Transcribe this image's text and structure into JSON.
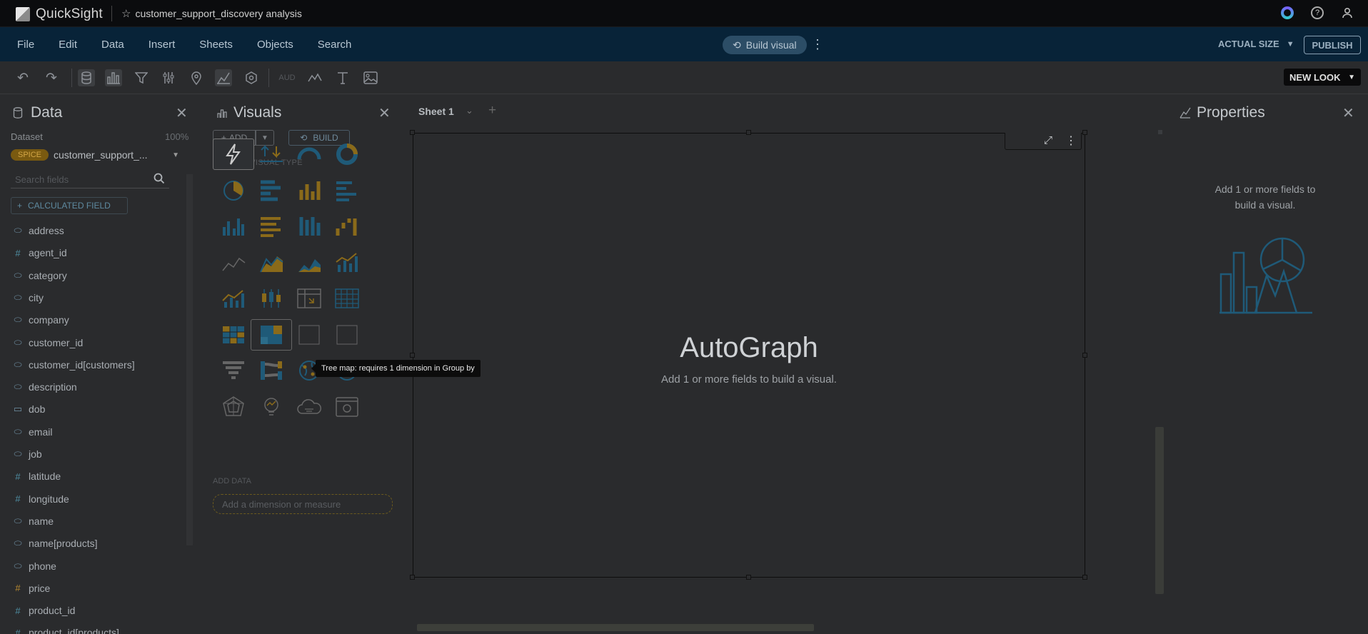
{
  "topbar": {
    "app_name": "QuickSight",
    "analysis_name": "customer_support_discovery analysis"
  },
  "menubar": {
    "menus": [
      "File",
      "Edit",
      "Data",
      "Insert",
      "Sheets",
      "Objects",
      "Search"
    ],
    "build_visual": "Build visual",
    "size_label": "ACTUAL SIZE",
    "publish": "PUBLISH"
  },
  "toolbar": {
    "new_look": "NEW LOOK",
    "aud_label": "AUD"
  },
  "data_panel": {
    "title": "Data",
    "dataset_label": "Dataset",
    "dataset_percent": "100%",
    "spice_badge": "SPICE",
    "dataset_name": "customer_support_...",
    "search_placeholder": "Search fields",
    "calc_field": "CALCULATED FIELD",
    "fields": [
      {
        "name": "address",
        "type": "dimension"
      },
      {
        "name": "agent_id",
        "type": "measure"
      },
      {
        "name": "category",
        "type": "dimension"
      },
      {
        "name": "city",
        "type": "dimension"
      },
      {
        "name": "company",
        "type": "dimension"
      },
      {
        "name": "customer_id",
        "type": "dimension"
      },
      {
        "name": "customer_id[customers]",
        "type": "dimension"
      },
      {
        "name": "description",
        "type": "dimension"
      },
      {
        "name": "dob",
        "type": "date"
      },
      {
        "name": "email",
        "type": "dimension"
      },
      {
        "name": "job",
        "type": "dimension"
      },
      {
        "name": "latitude",
        "type": "measure"
      },
      {
        "name": "longitude",
        "type": "measure"
      },
      {
        "name": "name",
        "type": "dimension"
      },
      {
        "name": "name[products]",
        "type": "dimension"
      },
      {
        "name": "phone",
        "type": "dimension"
      },
      {
        "name": "price",
        "type": "price"
      },
      {
        "name": "product_id",
        "type": "measure"
      },
      {
        "name": "product_id[products]",
        "type": "measure"
      }
    ]
  },
  "visuals_panel": {
    "title": "Visuals",
    "add": "ADD",
    "build": "BUILD",
    "change_type_label": "CHANGE VISUAL TYPE",
    "add_data_label": "ADD DATA",
    "add_data_placeholder": "Add a dimension or measure"
  },
  "sheet": {
    "tab_name": "Sheet 1"
  },
  "visual": {
    "title": "AutoGraph",
    "subtitle": "Add 1 or more fields to build a visual."
  },
  "properties": {
    "title": "Properties",
    "message": "Add 1 or more fields to build a visual."
  },
  "tooltip": "Tree map: requires 1 dimension in Group by"
}
